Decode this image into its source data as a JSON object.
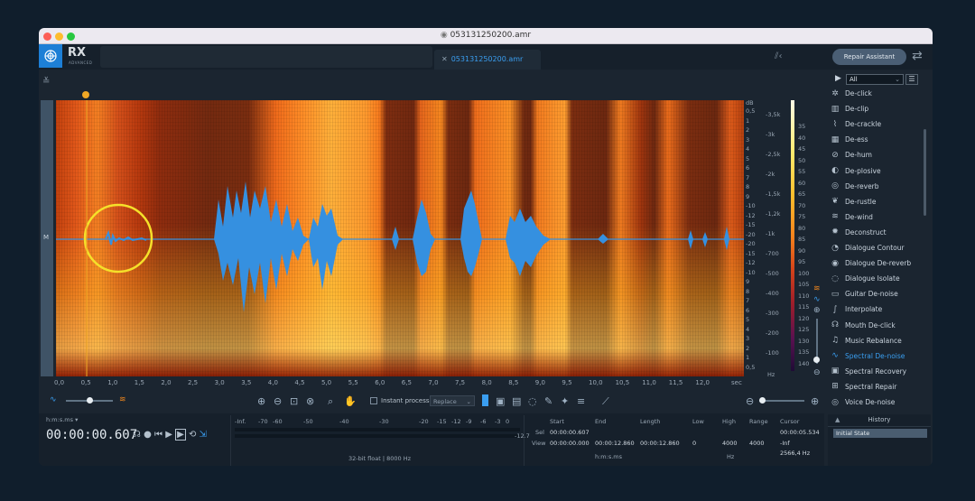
{
  "window": {
    "title": "053131250200.amr"
  },
  "app": {
    "logo_text": "RX",
    "logo_sub": "ADVANCED"
  },
  "tabs": [
    {
      "label": "053131250200.amr"
    }
  ],
  "header": {
    "repair_assistant": "Repair Assistant"
  },
  "track": {
    "channel_label": "M"
  },
  "time_axis": {
    "ticks": [
      "0,0",
      "0,5",
      "1,0",
      "1,5",
      "2,0",
      "2,5",
      "3,0",
      "3,5",
      "4,0",
      "4,5",
      "5,0",
      "5,5",
      "6,0",
      "6,5",
      "7,0",
      "7,5",
      "8,0",
      "8,5",
      "9,0",
      "9,5",
      "10,0",
      "10,5",
      "11,0",
      "11,5",
      "12,0"
    ],
    "unit": "sec"
  },
  "db_axis": {
    "unit": "dB",
    "ticks": [
      "0,5",
      "1",
      "2",
      "3",
      "4",
      "5",
      "6",
      "7",
      "8",
      "9",
      "-10",
      "-12",
      "-15",
      "-20",
      "-20",
      "-15",
      "-12",
      "-10",
      "9",
      "8",
      "7",
      "6",
      "5",
      "4",
      "3",
      "2",
      "1",
      "0,5"
    ]
  },
  "hz_axis": {
    "unit": "Hz",
    "ticks": [
      "-3,5k",
      "-3k",
      "-2,5k",
      "-2k",
      "-1,5k",
      "-1,2k",
      "-1k",
      "-700",
      "-500",
      "-400",
      "-300",
      "-200",
      "-100"
    ]
  },
  "colorbar_axis": {
    "unit": "dB",
    "ticks": [
      "35",
      "40",
      "45",
      "50",
      "55",
      "60",
      "65",
      "70",
      "75",
      "80",
      "85",
      "90",
      "95",
      "100",
      "105",
      "110",
      "115",
      "120",
      "125",
      "130",
      "135",
      "140"
    ]
  },
  "toolbar": {
    "instant_process": "Instant process",
    "mode": "Replace"
  },
  "status": {
    "timecode_format": "h:m:s.ms",
    "timecode": "00:00:00.607",
    "meter_ticks": [
      "-Inf.",
      "-70",
      "-60",
      "-50",
      "-40",
      "-30",
      "-20",
      "-15",
      "-12",
      "-9",
      "-6",
      "-3",
      "0"
    ],
    "meter_peak": "-12.7",
    "format": "32-bit float | 8000 Hz"
  },
  "selection": {
    "headers": {
      "start": "Start",
      "end": "End",
      "length": "Length",
      "low": "Low",
      "high": "High",
      "range": "Range",
      "cursor": "Cursor"
    },
    "sel_label": "Sel",
    "view_label": "View",
    "sel_start": "00:00:00.607",
    "view_start": "00:00:00.000",
    "view_end": "00:00:12.860",
    "view_length": "00:00:12.860",
    "low": "0",
    "high": "4000",
    "range": "4000",
    "cursor_time": "00:00:05.534",
    "cursor_db": "-Inf",
    "cursor_hz": "2566,4 Hz",
    "time_unit": "h:m:s.ms",
    "freq_unit": "Hz"
  },
  "modules_panel": {
    "filter": "All",
    "items": [
      {
        "label": "De-click",
        "icon": "declick-icon",
        "glyph": "✲"
      },
      {
        "label": "De-clip",
        "icon": "declip-icon",
        "glyph": "▥"
      },
      {
        "label": "De-crackle",
        "icon": "decrackle-icon",
        "glyph": "⌇"
      },
      {
        "label": "De-ess",
        "icon": "deess-icon",
        "glyph": "▦"
      },
      {
        "label": "De-hum",
        "icon": "dehum-icon",
        "glyph": "⊘"
      },
      {
        "label": "De-plosive",
        "icon": "deplosive-icon",
        "glyph": "◐"
      },
      {
        "label": "De-reverb",
        "icon": "dereverb-icon",
        "glyph": "◎"
      },
      {
        "label": "De-rustle",
        "icon": "derustle-icon",
        "glyph": "❦"
      },
      {
        "label": "De-wind",
        "icon": "dewind-icon",
        "glyph": "≋"
      },
      {
        "label": "Deconstruct",
        "icon": "deconstruct-icon",
        "glyph": "✹"
      },
      {
        "label": "Dialogue Contour",
        "icon": "dialogue-contour-icon",
        "glyph": "◔"
      },
      {
        "label": "Dialogue De-reverb",
        "icon": "dialogue-dereverb-icon",
        "glyph": "◉"
      },
      {
        "label": "Dialogue Isolate",
        "icon": "dialogue-isolate-icon",
        "glyph": "◌"
      },
      {
        "label": "Guitar De-noise",
        "icon": "guitar-denoise-icon",
        "glyph": "▭"
      },
      {
        "label": "Interpolate",
        "icon": "interpolate-icon",
        "glyph": "∫"
      },
      {
        "label": "Mouth De-click",
        "icon": "mouth-declick-icon",
        "glyph": "☊"
      },
      {
        "label": "Music Rebalance",
        "icon": "music-rebalance-icon",
        "glyph": "♫"
      },
      {
        "label": "Spectral De-noise",
        "icon": "spectral-denoise-icon",
        "glyph": "∿",
        "active": true
      },
      {
        "label": "Spectral Recovery",
        "icon": "spectral-recovery-icon",
        "glyph": "▣"
      },
      {
        "label": "Spectral Repair",
        "icon": "spectral-repair-icon",
        "glyph": "⊞"
      },
      {
        "label": "Voice De-noise",
        "icon": "voice-denoise-icon",
        "glyph": "◎"
      }
    ]
  },
  "history": {
    "title": "History",
    "items": [
      "Initial State"
    ]
  },
  "colors": {
    "accent": "#3a9ef0",
    "waveform": "#3590e0",
    "selection_circle": "#f5e02a"
  }
}
